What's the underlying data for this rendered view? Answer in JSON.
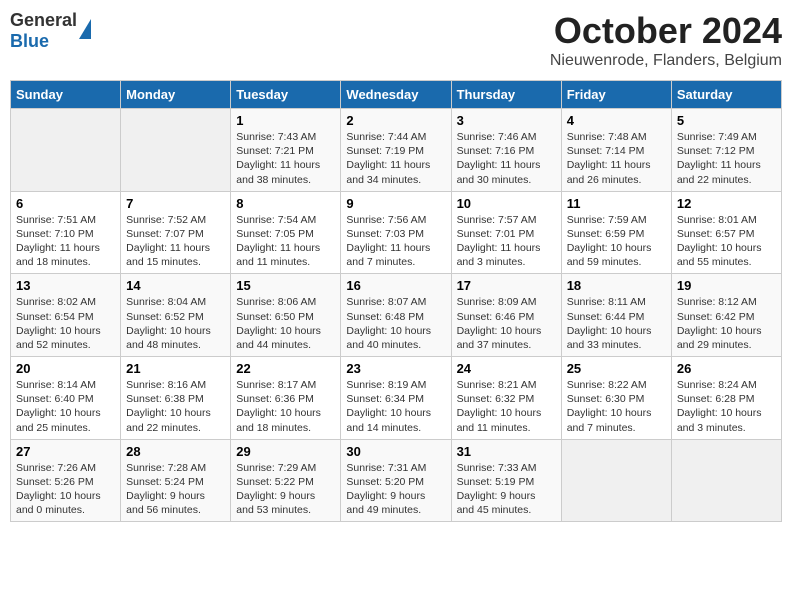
{
  "header": {
    "logo_general": "General",
    "logo_blue": "Blue",
    "title": "October 2024",
    "location": "Nieuwenrode, Flanders, Belgium"
  },
  "weekdays": [
    "Sunday",
    "Monday",
    "Tuesday",
    "Wednesday",
    "Thursday",
    "Friday",
    "Saturday"
  ],
  "weeks": [
    [
      {
        "num": "",
        "empty": true
      },
      {
        "num": "",
        "empty": true
      },
      {
        "num": "1",
        "sunrise": "7:43 AM",
        "sunset": "7:21 PM",
        "daylight": "11 hours and 38 minutes."
      },
      {
        "num": "2",
        "sunrise": "7:44 AM",
        "sunset": "7:19 PM",
        "daylight": "11 hours and 34 minutes."
      },
      {
        "num": "3",
        "sunrise": "7:46 AM",
        "sunset": "7:16 PM",
        "daylight": "11 hours and 30 minutes."
      },
      {
        "num": "4",
        "sunrise": "7:48 AM",
        "sunset": "7:14 PM",
        "daylight": "11 hours and 26 minutes."
      },
      {
        "num": "5",
        "sunrise": "7:49 AM",
        "sunset": "7:12 PM",
        "daylight": "11 hours and 22 minutes."
      }
    ],
    [
      {
        "num": "6",
        "sunrise": "7:51 AM",
        "sunset": "7:10 PM",
        "daylight": "11 hours and 18 minutes."
      },
      {
        "num": "7",
        "sunrise": "7:52 AM",
        "sunset": "7:07 PM",
        "daylight": "11 hours and 15 minutes."
      },
      {
        "num": "8",
        "sunrise": "7:54 AM",
        "sunset": "7:05 PM",
        "daylight": "11 hours and 11 minutes."
      },
      {
        "num": "9",
        "sunrise": "7:56 AM",
        "sunset": "7:03 PM",
        "daylight": "11 hours and 7 minutes."
      },
      {
        "num": "10",
        "sunrise": "7:57 AM",
        "sunset": "7:01 PM",
        "daylight": "11 hours and 3 minutes."
      },
      {
        "num": "11",
        "sunrise": "7:59 AM",
        "sunset": "6:59 PM",
        "daylight": "10 hours and 59 minutes."
      },
      {
        "num": "12",
        "sunrise": "8:01 AM",
        "sunset": "6:57 PM",
        "daylight": "10 hours and 55 minutes."
      }
    ],
    [
      {
        "num": "13",
        "sunrise": "8:02 AM",
        "sunset": "6:54 PM",
        "daylight": "10 hours and 52 minutes."
      },
      {
        "num": "14",
        "sunrise": "8:04 AM",
        "sunset": "6:52 PM",
        "daylight": "10 hours and 48 minutes."
      },
      {
        "num": "15",
        "sunrise": "8:06 AM",
        "sunset": "6:50 PM",
        "daylight": "10 hours and 44 minutes."
      },
      {
        "num": "16",
        "sunrise": "8:07 AM",
        "sunset": "6:48 PM",
        "daylight": "10 hours and 40 minutes."
      },
      {
        "num": "17",
        "sunrise": "8:09 AM",
        "sunset": "6:46 PM",
        "daylight": "10 hours and 37 minutes."
      },
      {
        "num": "18",
        "sunrise": "8:11 AM",
        "sunset": "6:44 PM",
        "daylight": "10 hours and 33 minutes."
      },
      {
        "num": "19",
        "sunrise": "8:12 AM",
        "sunset": "6:42 PM",
        "daylight": "10 hours and 29 minutes."
      }
    ],
    [
      {
        "num": "20",
        "sunrise": "8:14 AM",
        "sunset": "6:40 PM",
        "daylight": "10 hours and 25 minutes."
      },
      {
        "num": "21",
        "sunrise": "8:16 AM",
        "sunset": "6:38 PM",
        "daylight": "10 hours and 22 minutes."
      },
      {
        "num": "22",
        "sunrise": "8:17 AM",
        "sunset": "6:36 PM",
        "daylight": "10 hours and 18 minutes."
      },
      {
        "num": "23",
        "sunrise": "8:19 AM",
        "sunset": "6:34 PM",
        "daylight": "10 hours and 14 minutes."
      },
      {
        "num": "24",
        "sunrise": "8:21 AM",
        "sunset": "6:32 PM",
        "daylight": "10 hours and 11 minutes."
      },
      {
        "num": "25",
        "sunrise": "8:22 AM",
        "sunset": "6:30 PM",
        "daylight": "10 hours and 7 minutes."
      },
      {
        "num": "26",
        "sunrise": "8:24 AM",
        "sunset": "6:28 PM",
        "daylight": "10 hours and 3 minutes."
      }
    ],
    [
      {
        "num": "27",
        "sunrise": "7:26 AM",
        "sunset": "5:26 PM",
        "daylight": "10 hours and 0 minutes."
      },
      {
        "num": "28",
        "sunrise": "7:28 AM",
        "sunset": "5:24 PM",
        "daylight": "9 hours and 56 minutes."
      },
      {
        "num": "29",
        "sunrise": "7:29 AM",
        "sunset": "5:22 PM",
        "daylight": "9 hours and 53 minutes."
      },
      {
        "num": "30",
        "sunrise": "7:31 AM",
        "sunset": "5:20 PM",
        "daylight": "9 hours and 49 minutes."
      },
      {
        "num": "31",
        "sunrise": "7:33 AM",
        "sunset": "5:19 PM",
        "daylight": "9 hours and 45 minutes."
      },
      {
        "num": "",
        "empty": true
      },
      {
        "num": "",
        "empty": true
      }
    ]
  ],
  "labels": {
    "sunrise": "Sunrise:",
    "sunset": "Sunset:",
    "daylight": "Daylight:"
  }
}
